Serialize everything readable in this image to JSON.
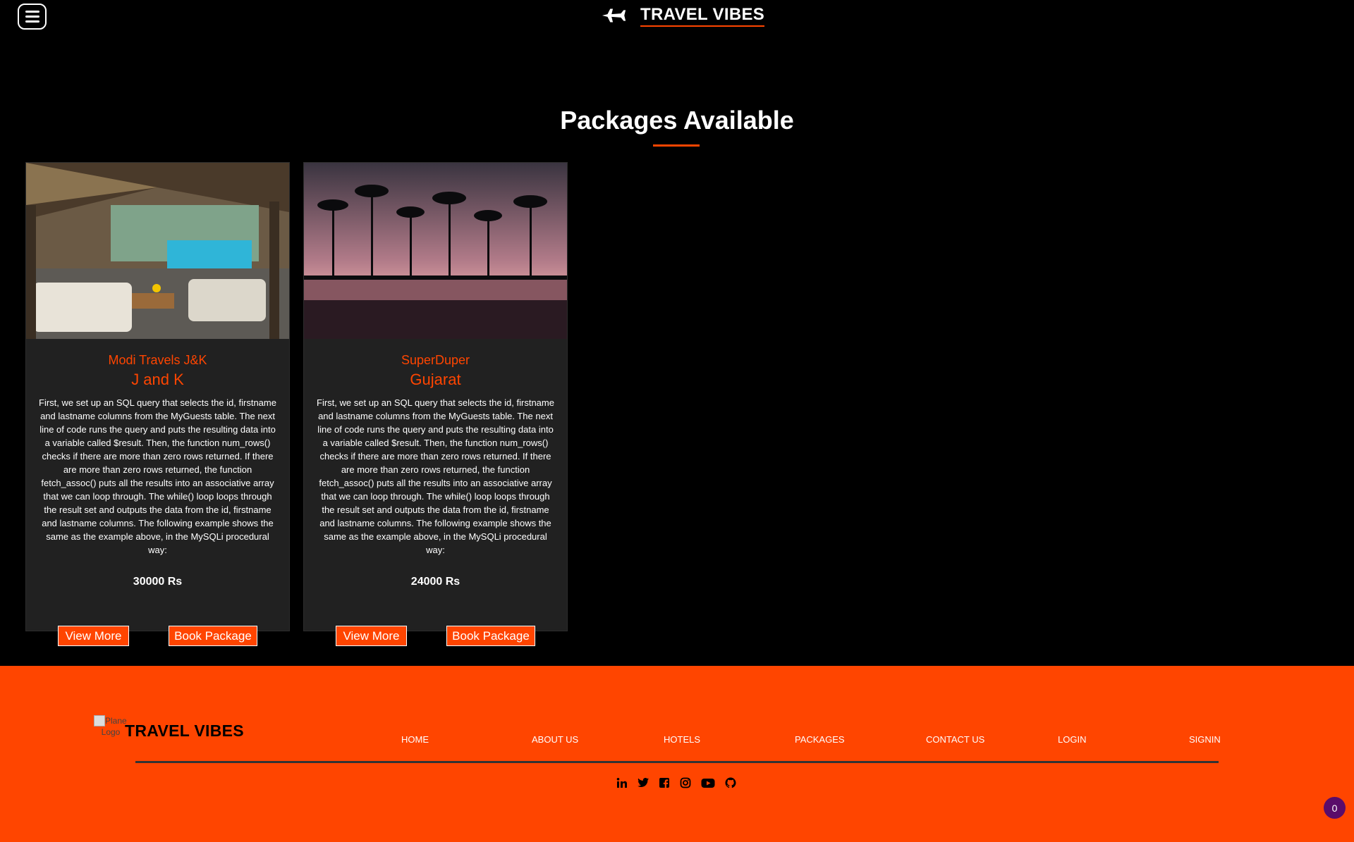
{
  "header": {
    "brand_title": "TRAVEL VIBES"
  },
  "section": {
    "title": "Packages Available"
  },
  "packages": [
    {
      "company": "Modi Travels J&K",
      "location": "J and K",
      "description": "First, we set up an SQL query that selects the id, firstname and lastname columns from the MyGuests table. The next line of code runs the query and puts the resulting data into a variable called $result. Then, the function num_rows() checks if there are more than zero rows returned. If there are more than zero rows returned, the function fetch_assoc() puts all the results into an associative array that we can loop through. The while() loop loops through the result set and outputs the data from the id, firstname and lastname columns. The following example shows the same as the example above, in the MySQLi procedural way:",
      "price": "30000 Rs",
      "view_label": "View More",
      "book_label": "Book Package"
    },
    {
      "company": "SuperDuper",
      "location": "Gujarat",
      "description": "First, we set up an SQL query that selects the id, firstname and lastname columns from the MyGuests table. The next line of code runs the query and puts the resulting data into a variable called $result. Then, the function num_rows() checks if there are more than zero rows returned. If there are more than zero rows returned, the function fetch_assoc() puts all the results into an associative array that we can loop through. The while() loop loops through the result set and outputs the data from the id, firstname and lastname columns. The following example shows the same as the example above, in the MySQLi procedural way:",
      "price": "24000 Rs",
      "view_label": "View More",
      "book_label": "Book Package"
    }
  ],
  "footer": {
    "logo_alt": "AirPlane Logo",
    "brand_title": "TRAVEL VIBES",
    "nav": [
      "HOME",
      "ABOUT US",
      "HOTELS",
      "PACKAGES",
      "CONTACT US",
      "LOGIN",
      "SIGNIN"
    ],
    "social_icons": [
      "linkedin-icon",
      "twitter-icon",
      "facebook-icon",
      "instagram-icon",
      "youtube-icon",
      "github-icon"
    ]
  },
  "badge": {
    "count": "0"
  },
  "colors": {
    "accent": "#ff4500",
    "background": "#000000",
    "card": "#212121",
    "footer_line": "#333333",
    "badge": "#5a0c6a"
  }
}
